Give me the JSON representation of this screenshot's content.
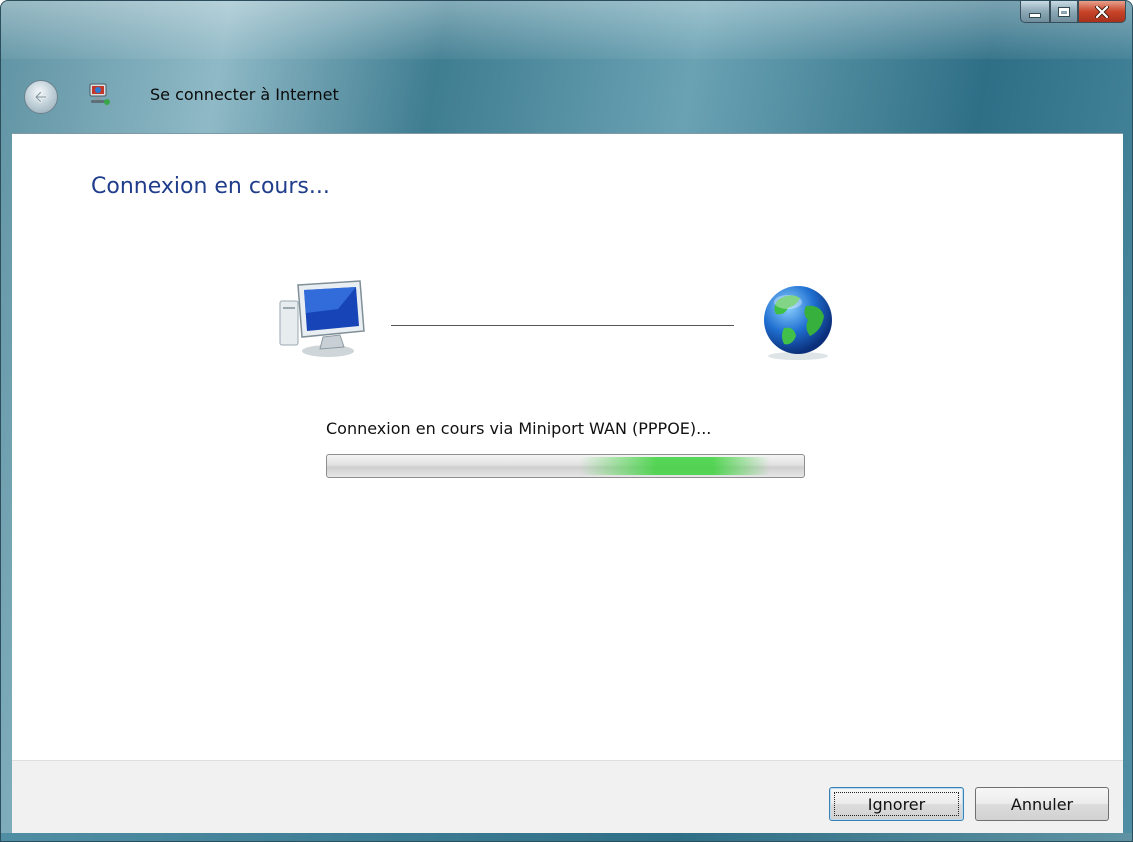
{
  "window": {
    "title": "Se connecter à Internet"
  },
  "page": {
    "heading": "Connexion en cours...",
    "status_text": "Connexion en cours via Miniport WAN (PPPOE)...",
    "progress_style": "marquee"
  },
  "footer": {
    "ignore_label": "Ignorer",
    "cancel_label": "Annuler"
  },
  "icons": {
    "back": "back-arrow-icon",
    "app": "network-connect-icon",
    "computer": "computer-icon",
    "globe": "globe-icon"
  },
  "colors": {
    "heading": "#1f3d8a",
    "progress_glow": "#3cd23c",
    "close_button": "#c8452a"
  }
}
